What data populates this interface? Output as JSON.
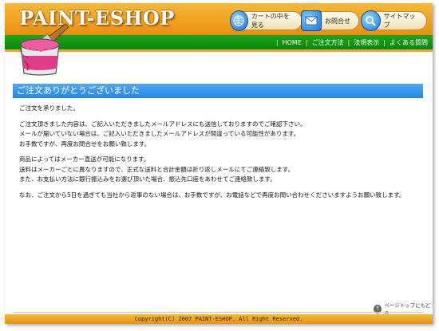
{
  "header": {
    "logo": "PAINT-ESHOP",
    "buttons": {
      "cart": "カートの中を見る",
      "contact": "お問合せ",
      "sitemap": "サイトマップ"
    }
  },
  "nav": {
    "items": [
      "HOME",
      "ご注文方法",
      "法規表示",
      "よくある質問"
    ]
  },
  "main": {
    "title": "ご注文ありがとうございました",
    "paragraphs": [
      [
        "ご注文を承りました。"
      ],
      [
        "ご注文頂きました内容は、ご記入いただきましたメールアドレスにも送信しておりますのでご確認下さい。",
        "メールが届いていない場合は、ご記入いただきましたメールアドレスが間違っている可能性があります。",
        "お手数ですが、再度お問合せをお願い致します。"
      ],
      [
        "商品によってはメーカー直送が可能になります。",
        "送料はメーカーごとに異なりますので、正式な送料と合計金額は折り返しメールにてご連絡致します。",
        "また、お支払い方法に銀行振込みをお選び頂いた場合、振込先口座をあわせてご連絡致します。"
      ],
      [
        "なお、ご注文から5日を過ぎても当社から返事のない場合は、お手数ですが、お電話などで再度お問い合わせくださいますようお願い致します。"
      ]
    ]
  },
  "page_top": "ページトップにもどる",
  "footer": {
    "copyright": "Copyright(C) 2007 PAINT-ESHOP. All Right Reserved."
  },
  "icons": {
    "cart": "globe-cart-icon",
    "contact": "envelope-icon",
    "sitemap": "magnifier-icon",
    "page_top": "up-arrow-icon"
  },
  "colors": {
    "header_orange": "#f1a826",
    "nav_green": "#1a9e1a",
    "title_blue": "#3399ee"
  }
}
